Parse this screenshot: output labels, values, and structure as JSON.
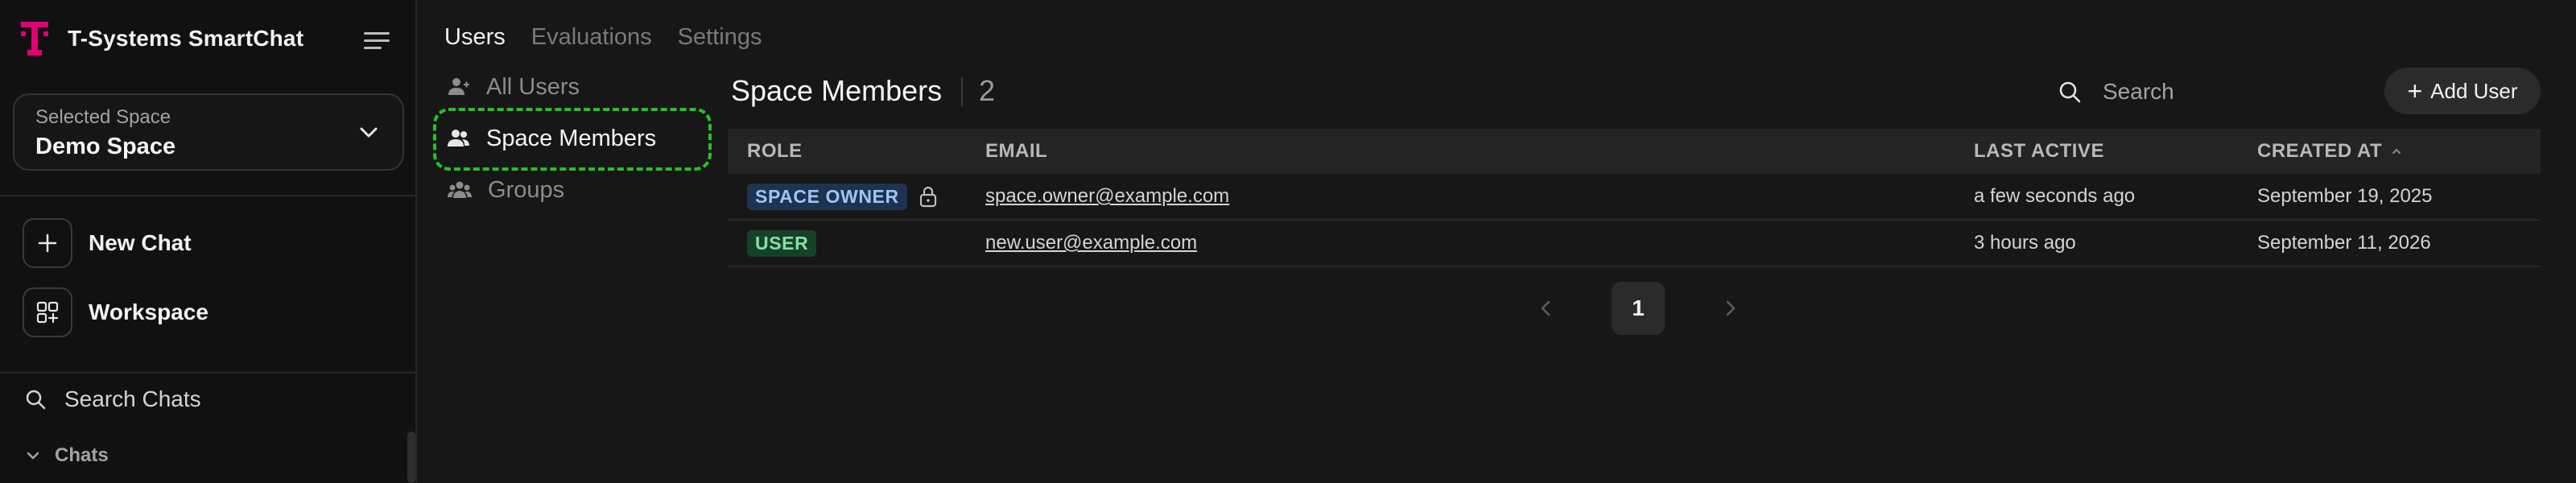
{
  "app": {
    "title": "T-Systems SmartChat",
    "brand_color": "#e20074",
    "logo": "t-logo-icon"
  },
  "sidebar": {
    "menu_icon": "menu-icon",
    "selected_space": {
      "caption": "Selected Space",
      "value": "Demo Space"
    },
    "actions": [
      {
        "label": "New Chat",
        "icon": "plus-icon"
      },
      {
        "label": "Workspace",
        "icon": "grid-icon"
      }
    ],
    "search_label": "Search Chats",
    "chats_section": "Chats"
  },
  "tabs": [
    {
      "label": "Users",
      "active": true
    },
    {
      "label": "Evaluations",
      "active": false
    },
    {
      "label": "Settings",
      "active": false
    }
  ],
  "subnav": [
    {
      "label": "All Users",
      "icon": "user-icon",
      "active": false
    },
    {
      "label": "Space Members",
      "icon": "users-icon",
      "active": true
    },
    {
      "label": "Groups",
      "icon": "group-icon",
      "active": false
    }
  ],
  "members": {
    "title": "Space Members",
    "count": "2",
    "search_placeholder": "Search",
    "add_user_label": "Add User",
    "columns": [
      "ROLE",
      "EMAIL",
      "LAST ACTIVE",
      "CREATED AT"
    ],
    "sort_column": "CREATED AT",
    "sort_direction": "ascending",
    "rows": [
      {
        "role": "SPACE OWNER",
        "role_type": "owner",
        "locked": true,
        "email": "space.owner@example.com",
        "last_active": "a few seconds ago",
        "created_at": "September 19, 2025"
      },
      {
        "role": "USER",
        "role_type": "user",
        "locked": false,
        "email": "new.user@example.com",
        "last_active": "3 hours ago",
        "created_at": "September 11, 2026"
      }
    ]
  },
  "pagination": {
    "current_page": "1"
  },
  "colors": {
    "highlight": "#22c322",
    "owner_badge_bg": "#1e3350",
    "user_badge_bg": "#17402a"
  }
}
